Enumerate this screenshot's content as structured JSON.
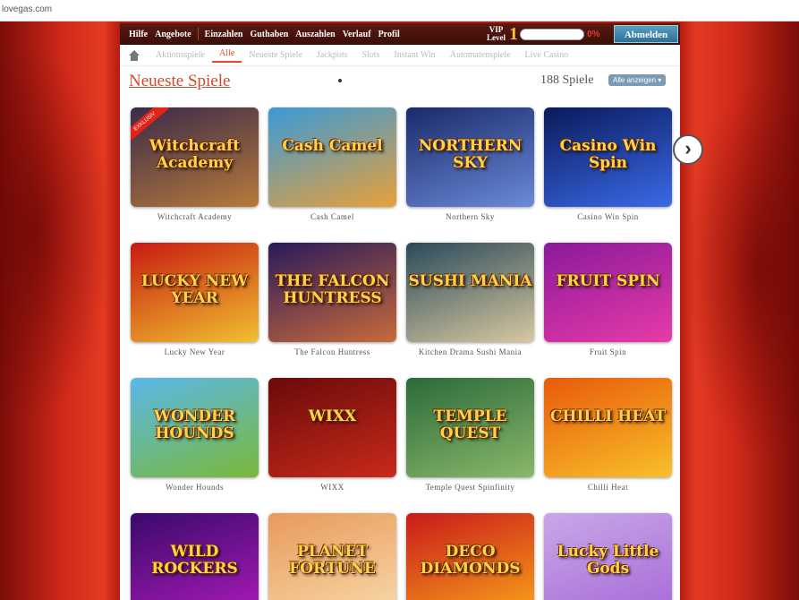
{
  "browser": {
    "url": "lovegas.com"
  },
  "topnav": {
    "items_left": [
      "Hilfe",
      "Angebote"
    ],
    "items_right": [
      "Einzahlen",
      "Guthaben",
      "Auszahlen",
      "Verlauf",
      "Profil"
    ],
    "vip_label_line1": "VIP",
    "vip_label_line2": "Level",
    "vip_level": "1",
    "vip_progress_percent": "0%",
    "vip_progress_fraction": 0,
    "logout_label": "Abmelden"
  },
  "subnav": {
    "tabs": [
      "Aktionsspiele",
      "Alle",
      "Neueste Spiele",
      "Jackpots",
      "Slots",
      "Instant Win",
      "Automatenspiele",
      "Live Casino"
    ],
    "active_tab_index": 1
  },
  "section": {
    "title": "Neueste Spiele",
    "count": "188 Spiele",
    "show_all": "Alle anzeigen ▾"
  },
  "games": [
    {
      "name": "Witchcraft Academy",
      "art": "Witchcraft Academy",
      "badge": "EXKLUSIV",
      "colors": [
        "#3b2a4a",
        "#b77a3a"
      ]
    },
    {
      "name": "Cash Camel",
      "art": "Cash Camel",
      "colors": [
        "#3a9ad8",
        "#e8a03a"
      ]
    },
    {
      "name": "Northern Sky",
      "art": "NORTHERN SKY",
      "colors": [
        "#1a2a6a",
        "#6a8ad8"
      ]
    },
    {
      "name": "Casino Win Spin",
      "art": "Casino Win Spin",
      "colors": [
        "#0a1a5a",
        "#3a6ae8"
      ]
    },
    {
      "name": "Lucky New Year",
      "art": "LUCKY NEW YEAR",
      "colors": [
        "#c81a10",
        "#f0c030"
      ]
    },
    {
      "name": "The Falcon Huntress",
      "art": "THE FALCON HUNTRESS",
      "colors": [
        "#2a1a5a",
        "#c86a3a"
      ]
    },
    {
      "name": "Kitchen Drama Sushi Mania",
      "art": "SUSHI MANIA",
      "colors": [
        "#2a4a5a",
        "#d8c8a0"
      ]
    },
    {
      "name": "Fruit Spin",
      "art": "FRUIT SPIN",
      "colors": [
        "#8a1a9a",
        "#e83aa8"
      ]
    },
    {
      "name": "Wonder Hounds",
      "art": "WONDER HOUNDS",
      "colors": [
        "#5ab8e8",
        "#7ab83a"
      ]
    },
    {
      "name": "WIXX",
      "art": "WIXX",
      "colors": [
        "#6a0a0a",
        "#c82a1a"
      ]
    },
    {
      "name": "Temple Quest Spinfinity",
      "art": "TEMPLE QUEST",
      "colors": [
        "#2a6a3a",
        "#8ab86a"
      ]
    },
    {
      "name": "Chilli Heat",
      "art": "CHILLI HEAT",
      "colors": [
        "#e85a0a",
        "#f8c02a"
      ]
    },
    {
      "name": "",
      "art": "WILD ROCKERS",
      "colors": [
        "#3a0a6a",
        "#a81ab8"
      ]
    },
    {
      "name": "",
      "art": "PLANET FORTUNE",
      "colors": [
        "#e89a5a",
        "#f8d8a8"
      ]
    },
    {
      "name": "",
      "art": "DECO DIAMONDS",
      "colors": [
        "#c81a1a",
        "#f8a01a"
      ]
    },
    {
      "name": "",
      "art": "Lucky Little Gods",
      "colors": [
        "#c8a8e8",
        "#a86ad8"
      ]
    }
  ]
}
